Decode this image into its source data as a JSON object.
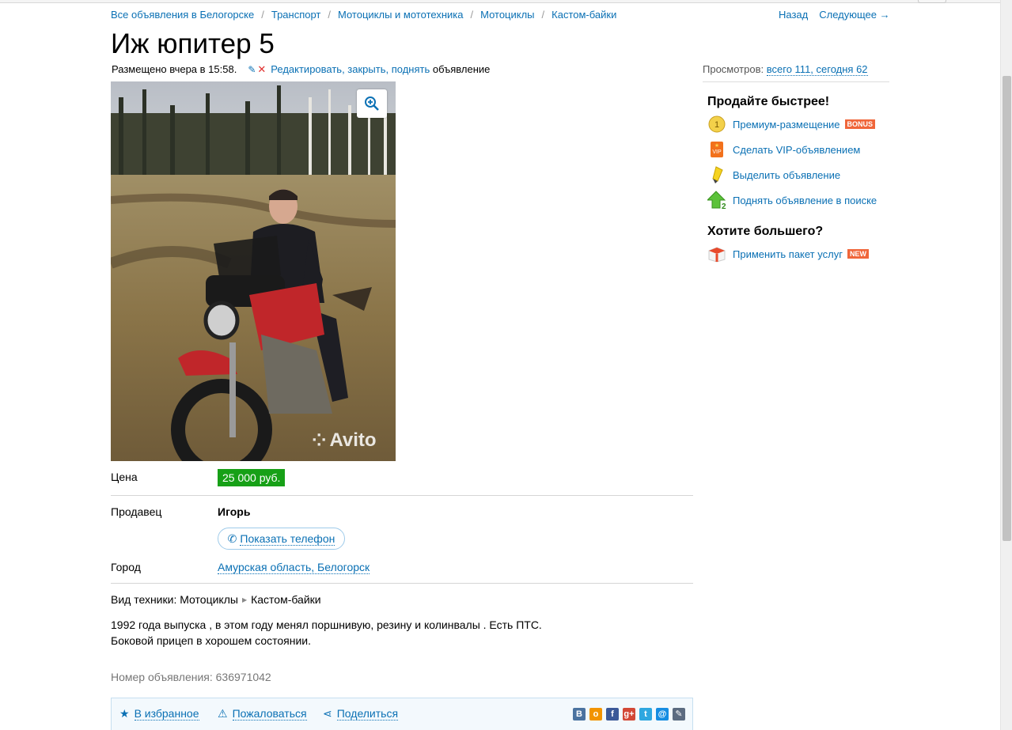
{
  "breadcrumbs": [
    "Все объявления в Белогорске",
    "Транспорт",
    "Мотоциклы и мототехника",
    "Мотоциклы",
    "Кастом-байки"
  ],
  "nav": {
    "back": "Назад",
    "next": "Следующее →"
  },
  "title": "Иж юпитер 5",
  "posted": {
    "text": "Размещено вчера в 15:58.",
    "edit": "Редактировать, закрыть, поднять",
    "suffix": "объявление"
  },
  "views": {
    "label": "Просмотров:",
    "value": "всего 111, сегодня 62"
  },
  "photo": {
    "watermark": "Avito"
  },
  "details": {
    "price_label": "Цена",
    "price": "25 000 руб.",
    "seller_label": "Продавец",
    "seller": "Игорь",
    "phone_button": "Показать телефон",
    "city_label": "Город",
    "city": "Амурская область, Белогорск"
  },
  "vehicle": {
    "label": "Вид техники:",
    "type": "Мотоциклы",
    "subtype": "Кастом-байки"
  },
  "description": [
    "1992 года выпуска , в этом году менял поршнивую, резину и колинвалы . Есть ПТС.",
    "Боковой прицеп в хорошем состоянии."
  ],
  "ad_number": "Номер объявления: 636971042",
  "actions": {
    "favorite": "В избранное",
    "report": "Пожаловаться",
    "share": "Поделиться"
  },
  "social": [
    {
      "name": "vk",
      "glyph": "B",
      "color": "#4b73a0"
    },
    {
      "name": "odnoklassniki",
      "glyph": "o",
      "color": "#f29400"
    },
    {
      "name": "facebook",
      "glyph": "f",
      "color": "#3b5998"
    },
    {
      "name": "google-plus",
      "glyph": "g+",
      "color": "#d34836"
    },
    {
      "name": "twitter",
      "glyph": "t",
      "color": "#2ea7e0"
    },
    {
      "name": "mailru",
      "glyph": "@",
      "color": "#168de2"
    },
    {
      "name": "livejournal",
      "glyph": "✎",
      "color": "#5b6b80"
    }
  ],
  "sidebar": {
    "sell_faster": "Продайте быстрее!",
    "items": [
      {
        "label": "Премиум-размещение",
        "badge": "BONUS",
        "icon": "coin-icon"
      },
      {
        "label": "Сделать VIP-объявлением",
        "icon": "vip-icon"
      },
      {
        "label": "Выделить объявление",
        "icon": "highlighter-icon"
      },
      {
        "label": "Поднять объявление в поиске",
        "icon": "arrow-up-icon"
      }
    ],
    "want_more": "Хотите большего?",
    "package": {
      "label": "Применить пакет услуг",
      "badge": "NEW",
      "icon": "gift-box-icon"
    }
  },
  "colors": {
    "link": "#0a70b4",
    "price_bg": "#17a017",
    "badge": "#f0663a"
  }
}
